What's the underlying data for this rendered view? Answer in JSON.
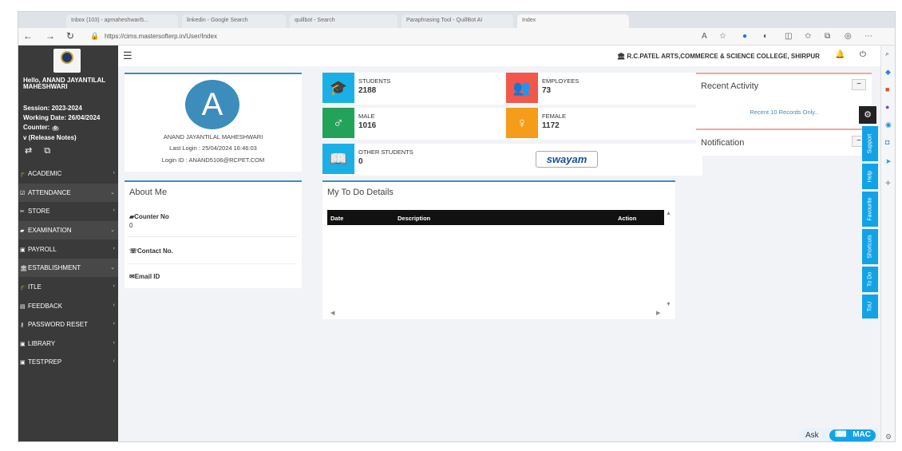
{
  "browser": {
    "tabs": [
      "Inbox (103) - apmaheshwari5...",
      "linkedin - Google Search",
      "quillbot - Search",
      "Paraphrasing Tool - QuillBot AI",
      "Index"
    ],
    "url": "https://cims.mastersofterp.in/User/Index"
  },
  "sidebar": {
    "greeting": "Hello, ANAND JAYANTILAL MAHESHWARI",
    "session": "Session: 2023-2024",
    "working_date": "Working Date: 26/04/2024",
    "counter_label": "Counter:",
    "counter_value": "0",
    "release_notes": "v (Release Notes)",
    "items": [
      {
        "label": "ACADEMIC",
        "icon": "graduation-cap-icon"
      },
      {
        "label": "ATTENDANCE",
        "icon": "check-square-icon"
      },
      {
        "label": "STORE",
        "icon": "scissors-icon"
      },
      {
        "label": "EXAMINATION",
        "icon": "book-icon"
      },
      {
        "label": "PAYROLL",
        "icon": "money-icon"
      },
      {
        "label": "ESTABLISHMENT",
        "icon": "bank-icon"
      },
      {
        "label": "ITLE",
        "icon": "graduation-cap-icon"
      },
      {
        "label": "FEEDBACK",
        "icon": "comment-icon"
      },
      {
        "label": "PASSWORD RESET",
        "icon": "key-icon"
      },
      {
        "label": "LIBRARY",
        "icon": "library-icon"
      },
      {
        "label": "TESTPREP",
        "icon": "testprep-icon"
      }
    ]
  },
  "header": {
    "college": "R.C.PATEL ARTS,COMMERCE & SCIENCE COLLEGE, SHIRPUR"
  },
  "profile": {
    "initial": "A",
    "name": "ANAND JAYANTILAL MAHESHWARI",
    "last_login": "Last Login : 25/04/2024 16:46:03",
    "login_id": "Login ID : ANAND5106@RCPET.COM"
  },
  "about": {
    "title": "About Me",
    "counter_label": "Counter No",
    "counter_value": "0",
    "contact_label": "Contact No.",
    "email_label": "Email ID"
  },
  "stats": [
    {
      "label": "STUDENTS",
      "value": "2188",
      "color": "#1ab0e6"
    },
    {
      "label": "EMPLOYEES",
      "value": "73",
      "color": "#f2574b"
    },
    {
      "label": "MALE",
      "value": "1016",
      "color": "#23a35a"
    },
    {
      "label": "FEMALE",
      "value": "1172",
      "color": "#f59c1a"
    },
    {
      "label": "OTHER STUDENTS",
      "value": "0",
      "color": "#1ab0e6"
    }
  ],
  "swayam": "swayam",
  "todo": {
    "title": "My To Do Details",
    "columns": [
      "Date",
      "Description",
      "Action"
    ]
  },
  "recent": {
    "title": "Recent Activity",
    "note": "Recent 10 Records Only.."
  },
  "notification": {
    "title": "Notification"
  },
  "side_tabs": [
    "Support",
    "Help",
    "Favourite",
    "Shortcuts",
    "To Do",
    "ToU"
  ],
  "ask": {
    "label": "Ask",
    "brand": "MAC"
  }
}
